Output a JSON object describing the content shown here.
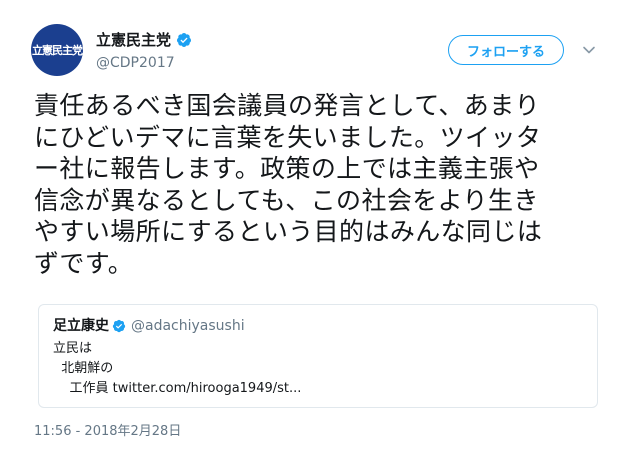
{
  "author": {
    "name": "立憲民主党",
    "handle": "@CDP2017",
    "avatar_text": "立憲民主党",
    "avatar_color": "#1b3f8f",
    "verified_icon": "verified-badge-icon"
  },
  "follow_button": {
    "label": "フォローする",
    "color": "#1da1f2"
  },
  "menu": {
    "icon": "chevron-down-icon"
  },
  "tweet": {
    "text": "責任あるべき国会議員の発言として、あまり\nにひどいデマに言葉を失いました。ツイッタ\nー社に報告します。政策の上では主義主張や\n信念が異なるとしても、この社会をより生き\nやすい場所にするという目的はみんな同じは\nずです。",
    "timestamp": "11:56 - 2018年2月28日"
  },
  "quoted_tweet": {
    "name": "足立康史",
    "handle": "@adachiyasushi",
    "verified_icon": "verified-badge-icon",
    "body": "立民は\n  北朝鮮の\n    工作員 twitter.com/hirooga1949/st..."
  }
}
